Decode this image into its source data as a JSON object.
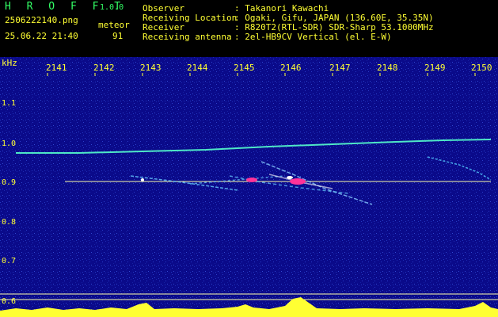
{
  "header": {
    "app_title": "H R O F F T",
    "version": "1.0.0",
    "filename": "2506222140.png",
    "datetime": "25.06.22 21:40",
    "type_label": "meteor",
    "count": "91",
    "info": [
      {
        "label": "Observer",
        "value": ": Takanori Kawachi"
      },
      {
        "label": "Receiving Location",
        "value": ": Ogaki, Gifu, JAPAN (136.60E, 35.35N)"
      },
      {
        "label": "Receiver",
        "value": ": R820T2(RTL-SDR) SDR-Sharp 53.1000MHz"
      },
      {
        "label": "Receiving antenna",
        "value": ": 2el-HB9CV Vertical (el. E-W)"
      }
    ]
  },
  "plot": {
    "unit": "kHz",
    "x_ticks": [
      "2141",
      "2142",
      "2143",
      "2144",
      "2145",
      "2146",
      "2147",
      "2148",
      "2149",
      "2150"
    ],
    "y_ticks": [
      "1.1",
      "1.0",
      "0.9",
      "0.8",
      "0.7",
      "0.6"
    ],
    "colors": {
      "background": "#0a0a8a",
      "trace": "#55ffcc",
      "yellow": "#ffff33",
      "reference": "#ffffaa",
      "echo_hot": "#ff3399"
    }
  }
}
